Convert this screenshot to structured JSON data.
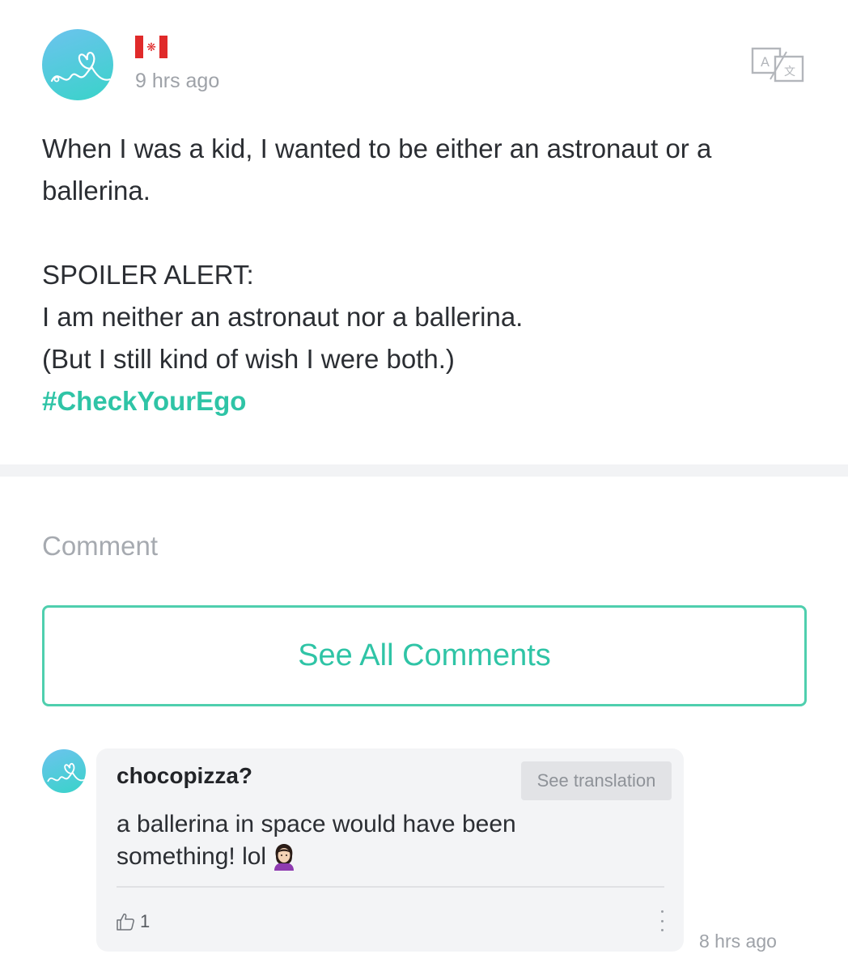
{
  "post": {
    "time": "9 hrs ago",
    "flag_icon": "canada-flag-icon",
    "translate_icon": "translate-icon",
    "body_line1": "When I was a kid, I wanted to be either an astronaut or a ballerina.",
    "body_line2": "SPOILER ALERT:",
    "body_line3": "I am neither an astronaut nor a ballerina.",
    "body_line4": "(But I still kind of wish I were both.)",
    "hashtag": "#CheckYourEgo"
  },
  "comments_section": {
    "label": "Comment",
    "see_all_label": "See All Comments"
  },
  "comment": {
    "username": "chocopizza?",
    "see_translation_label": "See translation",
    "text": "a ballerina in space would have been something! lol",
    "emoji": "person-shrugging-emoji",
    "like_count": "1",
    "time": "8 hrs ago"
  },
  "colors": {
    "accent": "#2fc4a6",
    "muted": "#9ea2a8",
    "card_bg": "#f3f4f6"
  }
}
